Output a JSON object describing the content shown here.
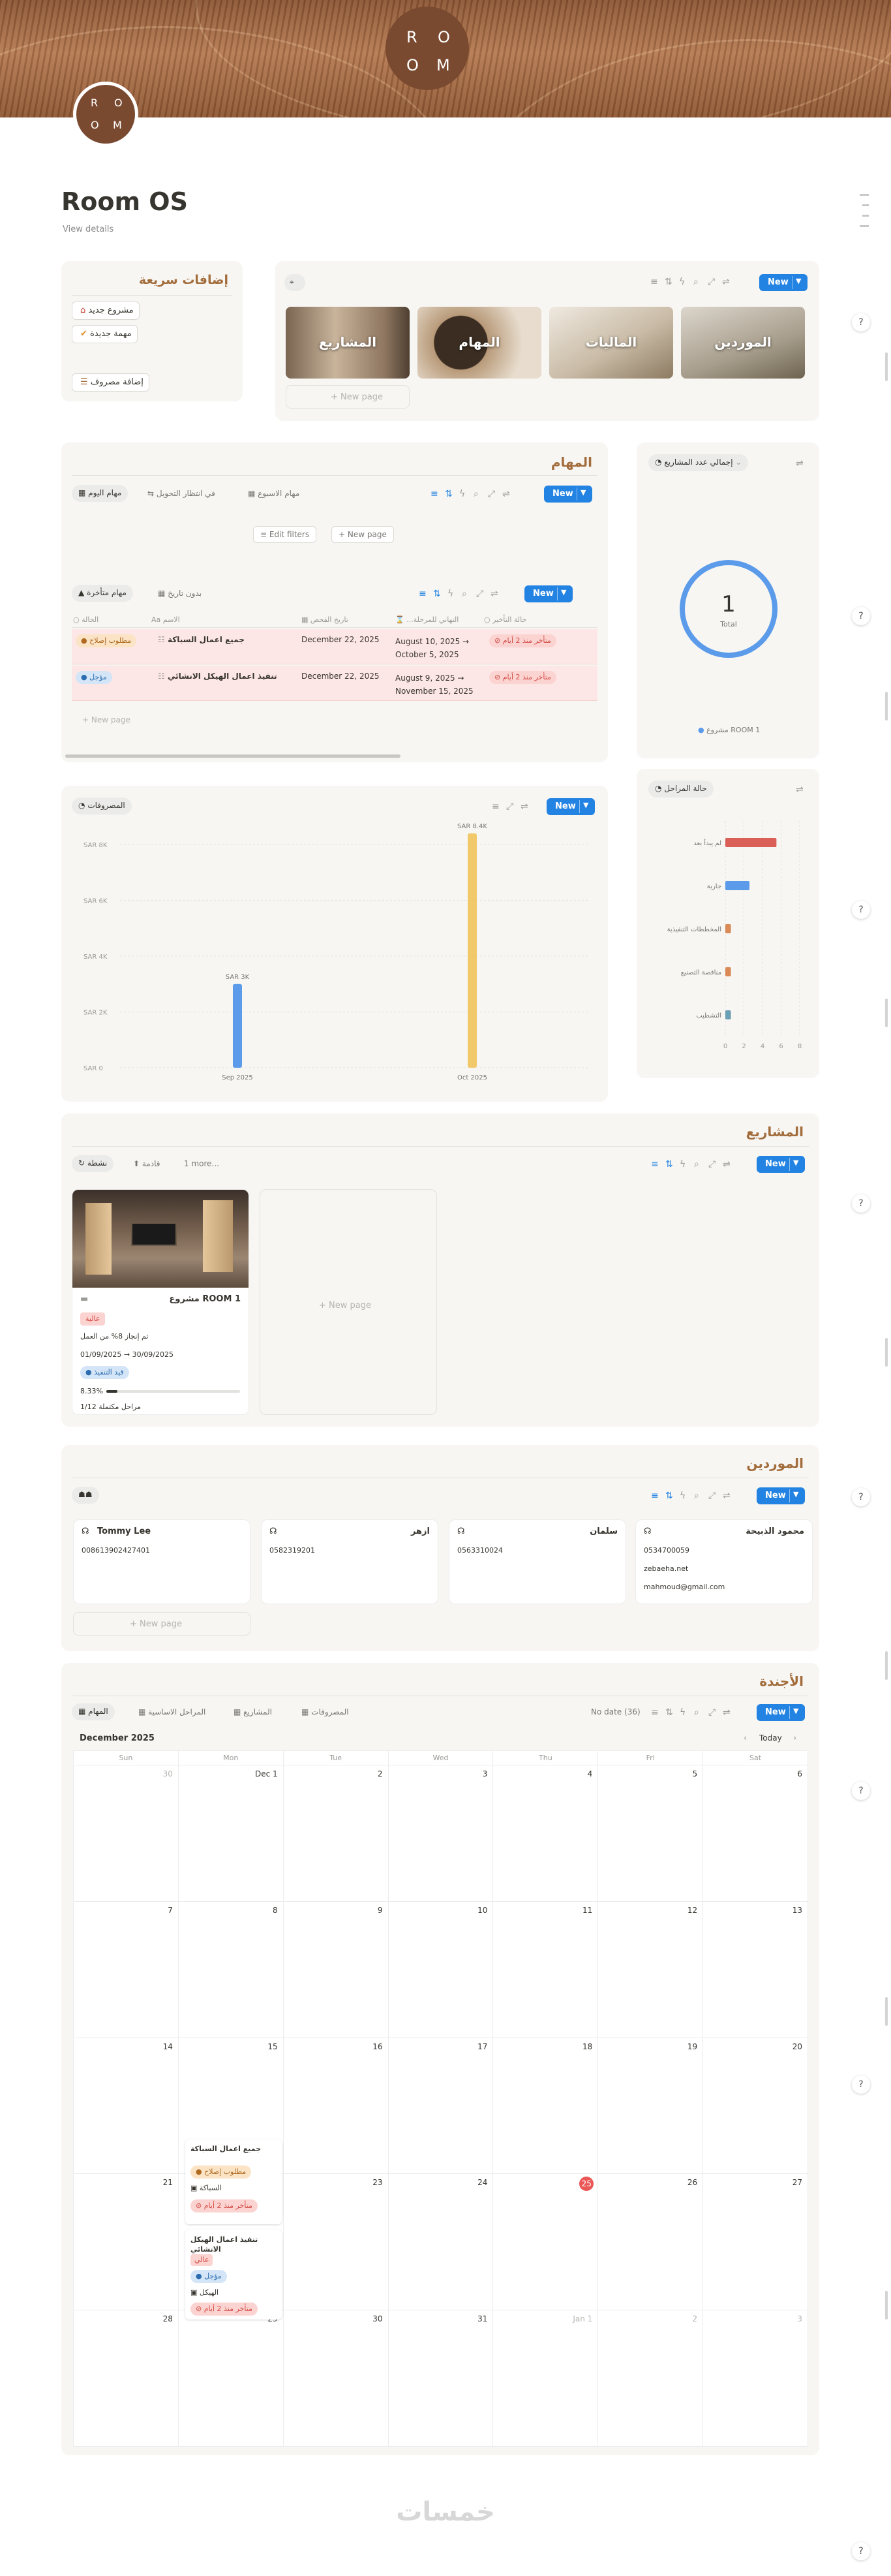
{
  "colors": {
    "accent": "#2383e2",
    "section_title": "#a26c3b",
    "brand": "#7a4a30",
    "red_row": "#fde7e6"
  },
  "hero": {
    "logo_lines": [
      "R",
      "O",
      "O",
      "M"
    ]
  },
  "page": {
    "title": "Room OS",
    "view_details": "View details"
  },
  "quick_add": {
    "title": "إضافات سريعة",
    "buttons": [
      {
        "label": "مشروع جديد",
        "icon": "blueprint-icon"
      },
      {
        "label": "مهمة جديدة",
        "icon": "check-circle-icon"
      },
      {
        "label": "إضافة مصروف",
        "icon": "receipt-icon"
      }
    ]
  },
  "nav_gallery": {
    "toolbar_new": "New",
    "cards": [
      "الموردين",
      "الماليات",
      "المهام",
      "المشاريع"
    ],
    "new_page": "New page"
  },
  "tasks": {
    "title": "المهام",
    "tabs": [
      "مهام اليوم",
      "في انتظار التحويل",
      "مهام الاسبوع"
    ],
    "edit_filters": "Edit filters",
    "new_page_btn": "New page",
    "new": "New",
    "tabs2": [
      "مهام متأخرة",
      "بدون تاريخ"
    ],
    "columns": [
      "الحالة",
      "الاسم",
      "تاريخ الفحص",
      "...التهاني للمرحلة",
      "حالة التأخير"
    ],
    "rows": [
      {
        "status": "مطلوب إصلاح",
        "name": "جميع اعمال السباكة",
        "check_date": "December 22, 2025",
        "range": "August 10, 2025 → October 5, 2025",
        "delay": "متأخر منذ 2 أيام"
      },
      {
        "status": "مؤجل",
        "name": "تنفيذ اعمال الهيكل الانشائي",
        "check_date": "December 22, 2025",
        "range": "August 9, 2025 → November 15, 2025",
        "delay": "متأخر منذ 2 أيام"
      }
    ],
    "new_page": "New page"
  },
  "projects_total": {
    "pill": "إجمالي عدد المشاريع",
    "value": "1",
    "value_label": "Total",
    "legend": "مشروع ROOM 1"
  },
  "expenses": {
    "pill": "المصروفات",
    "new": "New",
    "chart_data": {
      "type": "bar",
      "categories": [
        "Sep 2025",
        "Oct 2025"
      ],
      "values": [
        3000,
        8400
      ],
      "data_labels": [
        "SAR 3K",
        "SAR 8.4K"
      ],
      "y_ticks": [
        "SAR 0",
        "SAR 2K",
        "SAR 4K",
        "SAR 6K",
        "SAR 8K"
      ],
      "ylim": [
        0,
        8000
      ],
      "colors": [
        "#5b9bea",
        "#f2c96a"
      ],
      "grid": true
    }
  },
  "stages": {
    "pill": "حالة المراحل",
    "chart_data": {
      "type": "bar",
      "orientation": "horizontal",
      "categories": [
        "لم يبدأ بعد",
        "جارية",
        "المخططات التنفيذية",
        "مناقصة التصنيع",
        "التشطيب"
      ],
      "values": [
        5.5,
        2.6,
        0.6,
        0.6,
        0.6
      ],
      "x_ticks": [
        "0",
        "2",
        "4",
        "6",
        "8"
      ],
      "xlim": [
        0,
        8
      ],
      "colors": [
        "#d95f57",
        "#5b9bea",
        "#d98a56",
        "#d98a56",
        "#6b9fb3"
      ]
    }
  },
  "projects": {
    "title": "المشاريع",
    "tabs": [
      "نشطة",
      "قادمة",
      "1 more..."
    ],
    "new": "New",
    "card": {
      "name": "مشروع ROOM 1",
      "priority": "عالية",
      "note": "تم إنجاز 8% من العمل",
      "dates": "01/09/2025 → 30/09/2025",
      "status": "قيد التنفيذ",
      "progress": "8.33%",
      "progress_value": 8.33,
      "stages": "1/12 مراحل مكتملة"
    },
    "new_page": "New page"
  },
  "suppliers": {
    "title": "الموردين",
    "new": "New",
    "cards": [
      {
        "name": "محمود الذبيحة",
        "phone": "0534700059",
        "site": "zebaeha.net",
        "email": "mahmoud@gmail.com"
      },
      {
        "name": "سلمان",
        "phone": "0563310024"
      },
      {
        "name": "ازهر",
        "phone": "0582319201"
      },
      {
        "name": "Tommy Lee",
        "phone": "008613902427401"
      }
    ],
    "new_page": "New page"
  },
  "agenda": {
    "title": "الأجندة",
    "tabs": [
      "المهام",
      "المراحل الاساسية",
      "المشاريع",
      "المصروفات"
    ],
    "no_date": "No date (36)",
    "new": "New",
    "month": "December 2025",
    "today": "Today",
    "weekdays": [
      "Sun",
      "Mon",
      "Tue",
      "Wed",
      "Thu",
      "Fri",
      "Sat"
    ],
    "weeks": [
      [
        "30",
        "Dec 1",
        "2",
        "3",
        "4",
        "5",
        "6"
      ],
      [
        "7",
        "8",
        "9",
        "10",
        "11",
        "12",
        "13"
      ],
      [
        "14",
        "15",
        "16",
        "17",
        "18",
        "19",
        "20"
      ],
      [
        "21",
        "22",
        "23",
        "24",
        "25",
        "26",
        "27"
      ],
      [
        "28",
        "29",
        "30",
        "31",
        "Jan 1",
        "2",
        "3"
      ]
    ],
    "events": [
      {
        "title": "جميع اعمال السباكة",
        "tag": "مطلوب إصلاح",
        "project": "السباكة",
        "delay": "متأخر منذ 2 أيام"
      },
      {
        "title": "تنفيذ اعمال الهيكل الانشائي",
        "priority": "عالي",
        "tag": "مؤجل",
        "project": "الهيكل",
        "delay": "متأخر منذ 2 أيام"
      }
    ]
  },
  "watermark": "خمسات",
  "side_help": "?"
}
